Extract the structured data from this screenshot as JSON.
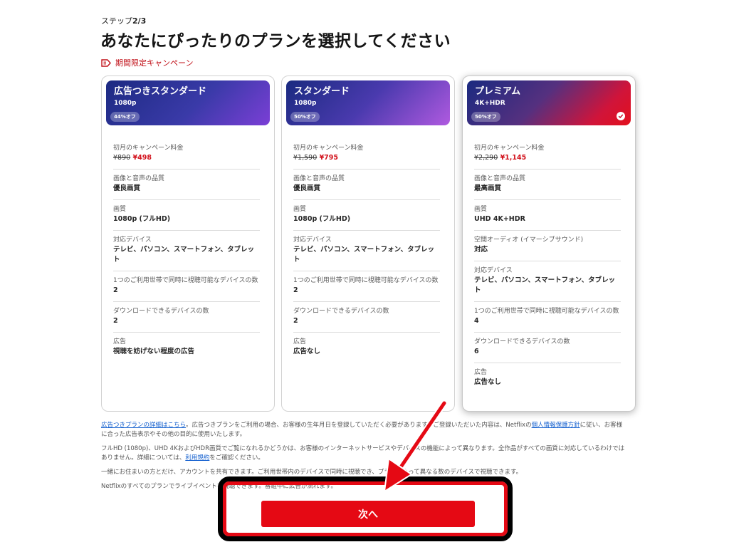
{
  "step": {
    "prefix": "ステップ",
    "value": "2/3"
  },
  "title": "あなたにぴったりのプランを選択してください",
  "promo": {
    "label": "期間限定キャンペーン",
    "icon": "tag-icon"
  },
  "plans": [
    {
      "name": "広告つきスタンダード",
      "resolution": "1080p",
      "badge": "44%オフ",
      "selected": false,
      "price_label": "初月のキャンペーン料金",
      "old_price": "¥890",
      "new_price": "¥498",
      "rows": [
        {
          "label": "画像と音声の品質",
          "value": "優良画質"
        },
        {
          "label": "画質",
          "value": "1080p (フルHD)"
        },
        {
          "label": "対応デバイス",
          "value": "テレビ、パソコン、スマートフォン、タブレット"
        },
        {
          "label": "1つのご利用世帯で同時に視聴可能なデバイスの数",
          "value": "2"
        },
        {
          "label": "ダウンロードできるデバイスの数",
          "value": "2"
        },
        {
          "label": "広告",
          "value": "視聴を妨げない程度の広告"
        }
      ]
    },
    {
      "name": "スタンダード",
      "resolution": "1080p",
      "badge": "50%オフ",
      "selected": false,
      "price_label": "初月のキャンペーン料金",
      "old_price": "¥1,590",
      "new_price": "¥795",
      "rows": [
        {
          "label": "画像と音声の品質",
          "value": "優良画質"
        },
        {
          "label": "画質",
          "value": "1080p (フルHD)"
        },
        {
          "label": "対応デバイス",
          "value": "テレビ、パソコン、スマートフォン、タブレット"
        },
        {
          "label": "1つのご利用世帯で同時に視聴可能なデバイスの数",
          "value": "2"
        },
        {
          "label": "ダウンロードできるデバイスの数",
          "value": "2"
        },
        {
          "label": "広告",
          "value": "広告なし"
        }
      ]
    },
    {
      "name": "プレミアム",
      "resolution": "4K+HDR",
      "badge": "50%オフ",
      "selected": true,
      "price_label": "初月のキャンペーン料金",
      "old_price": "¥2,290",
      "new_price": "¥1,145",
      "rows": [
        {
          "label": "画像と音声の品質",
          "value": "最高画質"
        },
        {
          "label": "画質",
          "value": "UHD 4K+HDR"
        },
        {
          "label": "空間オーディオ (イマーシブサウンド)",
          "value": "対応"
        },
        {
          "label": "対応デバイス",
          "value": "テレビ、パソコン、スマートフォン、タブレット"
        },
        {
          "label": "1つのご利用世帯で同時に視聴可能なデバイスの数",
          "value": "4"
        },
        {
          "label": "ダウンロードできるデバイスの数",
          "value": "6"
        },
        {
          "label": "広告",
          "value": "広告なし"
        }
      ]
    }
  ],
  "notes": {
    "p1_link": "広告つきプランの詳細はこちら",
    "p1_text": "。広告つきプランをご利用の場合、お客様の生年月日を登録していただく必要があります。ご登録いただいた内容は、Netflixの",
    "p1_link2": "個人情報保護方針",
    "p1_text2": "に従い、お客様に合った広告表示やその他の目的に使用いたします。",
    "p2_text": "フルHD (1080p)、UHD 4KおよびHDR画質でご覧になれるかどうかは、お客様のインターネットサービスやデバイスの機能によって異なります。全作品がすべての画質に対応しているわけではありません。詳細については、",
    "p2_link": "利用規約",
    "p2_text2": "をご確認ください。",
    "p3_text": "一緒にお住まいの方とだけ、アカウントを共有できます。ご利用世帯内のデバイスで同時に視聴でき、プランによって異なる数のデバイスで視聴できます。",
    "p4_text": "Netflixのすべてのプランでライブイベントを視聴できます。番組中に広告が流れます。"
  },
  "next_button": "次へ",
  "colors": {
    "accent": "#e50914",
    "price": "#d2111b",
    "link": "#1460cf"
  }
}
